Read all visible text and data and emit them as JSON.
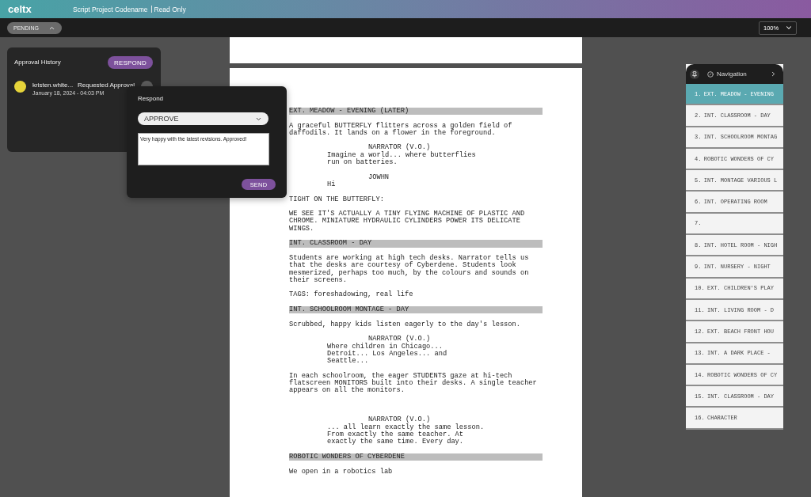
{
  "header": {
    "logo": "celtx",
    "project_title": "Script Project Codename",
    "access": "Read Only"
  },
  "toolbar": {
    "status": {
      "label": "PENDING",
      "expanded": true
    },
    "zoom": "100%"
  },
  "approval_history": {
    "title": "Approval History",
    "respond_button": "RESPOND",
    "entries": [
      {
        "user": "kristen.white...",
        "action": "Requested Approval",
        "date": "January 18, 2024 - 04:03 PM",
        "color": "#e6d43a"
      }
    ]
  },
  "respond_dialog": {
    "title": "Respond",
    "decision": "APPROVE",
    "comment": "Very happy with the latest revisions. Approved!",
    "send_button": "SEND"
  },
  "script": {
    "elements": [
      {
        "kind": "heading",
        "text": "EXT. MEADOW - EVENING (LATER)"
      },
      {
        "kind": "action",
        "text": "A graceful BUTTERFLY flitters across a golden field of daffodils. It lands on a flower in the foreground."
      },
      {
        "kind": "character",
        "text": "NARRATOR (V.O.)"
      },
      {
        "kind": "dialogue",
        "text": "Imagine a world... where butterflies run on batteries."
      },
      {
        "kind": "character",
        "text": "JOWHN"
      },
      {
        "kind": "dialogue",
        "text": "Hi"
      },
      {
        "kind": "action",
        "text": "TIGHT ON THE BUTTERFLY:"
      },
      {
        "kind": "action",
        "text": "WE SEE IT'S ACTUALLY A TINY FLYING MACHINE OF PLASTIC AND CHROME. MINIATURE HYDRAULIC CYLINDERS POWER ITS DELICATE WINGS."
      },
      {
        "kind": "heading",
        "text": "INT. CLASSROOM - DAY"
      },
      {
        "kind": "action",
        "text": "Students are working at high tech desks. Narrator tells us that the desks are courtesy of Cyberdene. Students look mesmerized, perhaps too much, by the colours and sounds on their screens."
      },
      {
        "kind": "action",
        "text": "TAGS: foreshadowing, real life"
      },
      {
        "kind": "heading",
        "text": "INT. SCHOOLROOM MONTAGE - DAY"
      },
      {
        "kind": "action",
        "text": "Scrubbed, happy kids listen eagerly to the day's lesson."
      },
      {
        "kind": "character",
        "text": "NARRATOR (V.O.)"
      },
      {
        "kind": "dialogue",
        "text": "Where children in Chicago... Detroit... Los Angeles... and Seattle..."
      },
      {
        "kind": "action",
        "text": "In each schoolroom, the eager STUDENTS gaze at hi-tech flatscreen MONITORS built into their desks. A single teacher appears on all the monitors."
      },
      {
        "kind": "blank"
      },
      {
        "kind": "character",
        "text": "NARRATOR (V.O.)"
      },
      {
        "kind": "dialogue",
        "text": "... all learn exactly the same lesson. From exactly the same teacher. At exactly the same time. Every day."
      },
      {
        "kind": "heading",
        "text": "ROBOTIC WONDERS OF CYBERDENE"
      },
      {
        "kind": "action",
        "text": "We open in a robotics lab"
      }
    ]
  },
  "navigation": {
    "title": "Navigation",
    "scenes": [
      {
        "number": "1.",
        "title": "EXT. MEADOW - EVENING",
        "selected": true
      },
      {
        "number": "2.",
        "title": "INT. CLASSROOM - DAY",
        "selected": false
      },
      {
        "number": "3.",
        "title": "INT. SCHOOLROOM MONTAG",
        "selected": false
      },
      {
        "number": "4.",
        "title": "ROBOTIC WONDERS OF CY",
        "selected": false
      },
      {
        "number": "5.",
        "title": "INT. MONTAGE VARIOUS L",
        "selected": false
      },
      {
        "number": "6.",
        "title": "INT. OPERATING ROOM",
        "selected": false
      },
      {
        "number": "7.",
        "selected": false
      },
      {
        "number": "8.",
        "title": "INT. HOTEL ROOM - NIGH",
        "selected": false
      },
      {
        "number": "9.",
        "title": "INT. NURSERY - NIGHT",
        "selected": false
      },
      {
        "number": "10.",
        "title": "EXT. CHILDREN'S PLAY",
        "selected": false
      },
      {
        "number": "11.",
        "title": "INT. LIVING ROOM - D",
        "selected": false
      },
      {
        "number": "12.",
        "title": "EXT. BEACH FRONT HOU",
        "selected": false
      },
      {
        "number": "13.",
        "title": "INT. A DARK PLACE -",
        "selected": false
      },
      {
        "number": "14.",
        "title": "ROBOTIC WONDERS OF CY",
        "selected": false
      },
      {
        "number": "15.",
        "title": "INT. CLASSROOM - DAY",
        "selected": false
      },
      {
        "number": "16.",
        "title": "CHARACTER",
        "selected": false
      }
    ]
  }
}
